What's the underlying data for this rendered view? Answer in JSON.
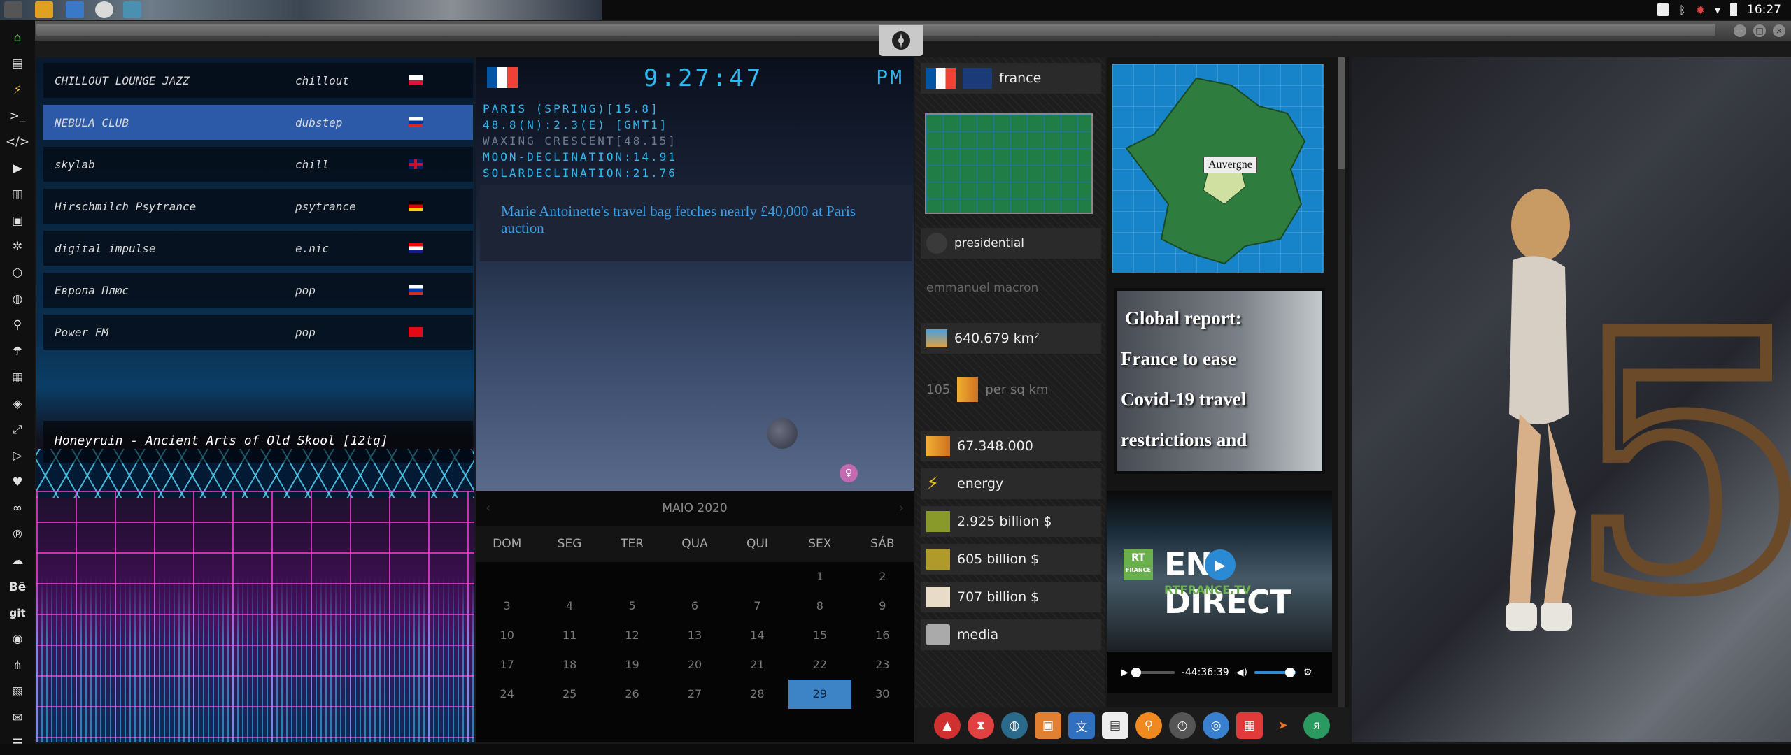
{
  "topbar": {
    "clock": "16:27",
    "tray_icons": [
      "fan-icon",
      "bluetooth-icon",
      "settings-gear-icon",
      "wifi-icon",
      "battery-icon"
    ]
  },
  "dock_icons": [
    "home-icon",
    "document-icon",
    "bolt-icon",
    "terminal-icon",
    "code-icon",
    "play-icon",
    "book-icon",
    "image-icon",
    "aperture-icon",
    "hexagon-icon",
    "globe-icon",
    "search-icon",
    "umbrella-icon",
    "contacts-icon",
    "tag-icon",
    "fullscreen-icon",
    "youtube-icon",
    "heart-icon",
    "lastfm-icon",
    "pinterest-icon",
    "cloud-icon",
    "behance-icon",
    "git-icon",
    "github-icon",
    "sitemap-icon",
    "map-icon",
    "mail-icon",
    "list-icon"
  ],
  "dock_labels": {
    "behance": "Bē",
    "git": "git"
  },
  "radio": {
    "stations": [
      {
        "name": "CHILLOUT LOUNGE JAZZ",
        "genre": "chillout",
        "flag": "pl"
      },
      {
        "name": "NEBULA CLUB",
        "genre": "dubstep",
        "flag": "ru"
      },
      {
        "name": "skylab",
        "genre": "chill",
        "flag": "gb"
      },
      {
        "name": "Hirschmilch Psytrance",
        "genre": "psytrance",
        "flag": "de"
      },
      {
        "name": "digital impulse",
        "genre": "e.nic",
        "flag": "hr"
      },
      {
        "name": "Европа Плюс",
        "genre": "pop",
        "flag": "ru"
      },
      {
        "name": "Power FM",
        "genre": "pop",
        "flag": "tr"
      }
    ],
    "now_playing": "Honeyruin - Ancient Arts of Old Skool [12tq]"
  },
  "astro": {
    "time": "9:27:47",
    "ampm": "PM",
    "lines": [
      "PARIS (SPRING)[15.8]",
      "48.8(N):2.3(E) [GMT1]",
      "WAXING CRESCENT[48.15]",
      "MOON-DECLINATION:14.91",
      "SOLARDECLINATION:21.76"
    ],
    "headline": "Marie Antoinette's travel bag fetches nearly £40,000 at Paris auction"
  },
  "calendar": {
    "month": "MAIO 2020",
    "prev": "‹",
    "next": "›",
    "weekdays": [
      "DOM",
      "SEG",
      "TER",
      "QUA",
      "QUI",
      "SEX",
      "SÁB"
    ],
    "weeks": [
      [
        "",
        "",
        "",
        "",
        "",
        "1",
        "2"
      ],
      [
        "3",
        "4",
        "5",
        "6",
        "7",
        "8",
        "9"
      ],
      [
        "10",
        "11",
        "12",
        "13",
        "14",
        "15",
        "16"
      ],
      [
        "17",
        "18",
        "19",
        "20",
        "21",
        "22",
        "23"
      ],
      [
        "24",
        "25",
        "26",
        "27",
        "28",
        "29",
        "30"
      ]
    ],
    "today": "29"
  },
  "country": {
    "name": "france",
    "government": "presidential",
    "leader": "emmanuel macron",
    "area": "640.679 km²",
    "density_value": "105",
    "density_unit": "per sq km",
    "population": "67.348.000",
    "energy": "energy",
    "gdp": "2.925 billion $",
    "exports": "605 billion $",
    "imports": "707 billion $",
    "media": "media"
  },
  "map": {
    "region_label": "Auvergne"
  },
  "news_image": {
    "lines": [
      "Global report:",
      "France to ease",
      "Covid-19 travel",
      "restrictions and"
    ]
  },
  "video": {
    "logo": "RT",
    "logo_sub": "FRANCE",
    "title": "EN DIRECT",
    "site": "RTFRANCE.TV",
    "time": "-44:36:39",
    "progress": 0.03,
    "volume": 0.85
  },
  "colors": {
    "accent_cyan": "#2fb8f0",
    "calendar_today": "#3d84c6",
    "station_active": "#2d5aa8"
  }
}
